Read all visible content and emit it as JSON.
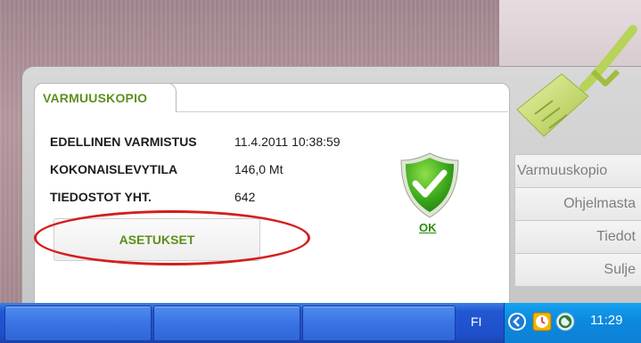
{
  "tab": {
    "label": "VARMUUSKOPIO"
  },
  "info": {
    "rows": [
      {
        "label": "EDELLINEN VARMISTUS",
        "value": "11.4.2011 10:38:59"
      },
      {
        "label": "KOKONAISLEVYTILA",
        "value": "146,0 Mt"
      },
      {
        "label": "TIEDOSTOT YHT.",
        "value": "642"
      }
    ]
  },
  "settings_button": {
    "label": "ASETUKSET"
  },
  "status": {
    "ok_label": "OK",
    "icon": "shield-check-icon"
  },
  "menu": {
    "items": [
      {
        "label": "Varmuuskopio"
      },
      {
        "label": "Ohjelmasta"
      },
      {
        "label": "Tiedot"
      },
      {
        "label": "Sulje"
      }
    ]
  },
  "taskbar": {
    "language": "FI",
    "clock": "11:29"
  },
  "colors": {
    "accent_green": "#5f8f1f",
    "highlight_red": "#d41e1e",
    "taskbar_blue": "#2258d3"
  }
}
